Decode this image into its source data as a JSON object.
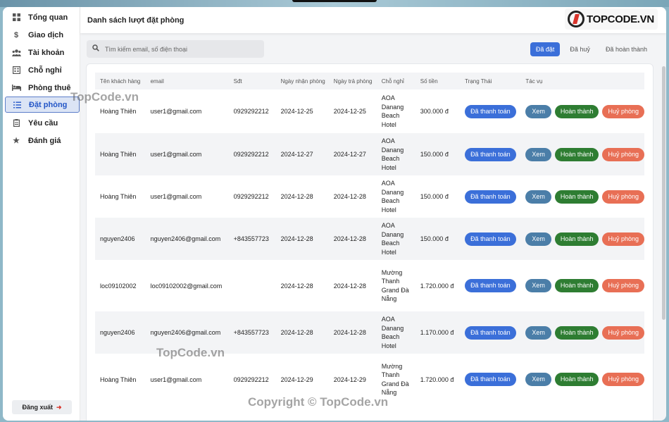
{
  "sidebar": {
    "items": [
      {
        "label": "Tổng quan",
        "icon": "grid-icon"
      },
      {
        "label": "Giao dịch",
        "icon": "dollar-icon"
      },
      {
        "label": "Tài khoản",
        "icon": "users-icon"
      },
      {
        "label": "Chỗ nghỉ",
        "icon": "building-icon"
      },
      {
        "label": "Phòng thuê",
        "icon": "bed-icon"
      },
      {
        "label": "Đặt phòng",
        "icon": "list-icon"
      },
      {
        "label": "Yêu cầu",
        "icon": "clipboard-icon"
      },
      {
        "label": "Đánh giá",
        "icon": "star-icon"
      }
    ],
    "active_index": 5,
    "logout_label": "Đăng xuất"
  },
  "header": {
    "title": "Danh sách lượt đặt phòng",
    "brand": {
      "part1": "TOP",
      "part2": "CODE.VN"
    }
  },
  "search": {
    "placeholder": "Tìm kiếm email, số điện thoại"
  },
  "filters": {
    "booked": "Đã đặt",
    "cancelled": "Đã huỷ",
    "completed": "Đã hoàn thành"
  },
  "table": {
    "columns": [
      "Tên khách hàng",
      "email",
      "Sđt",
      "Ngày nhận phòng",
      "Ngày trả phòng",
      "Chỗ nghỉ",
      "Số tiền",
      "Trạng Thái",
      "Tác vụ"
    ],
    "status_label": "Đã thanh toán",
    "view_label": "Xem",
    "complete_label": "Hoàn thành",
    "cancel_label": "Huỷ phòng",
    "rows": [
      {
        "name": "Hoàng Thiên",
        "email": "user1@gmail.com",
        "phone": "0929292212",
        "checkin": "2024-12-25",
        "checkout": "2024-12-25",
        "place": "AOA Danang Beach Hotel",
        "amount": "300.000 đ"
      },
      {
        "name": "Hoàng Thiên",
        "email": "user1@gmail.com",
        "phone": "0929292212",
        "checkin": "2024-12-27",
        "checkout": "2024-12-27",
        "place": "AOA Danang Beach Hotel",
        "amount": "150.000 đ"
      },
      {
        "name": "Hoàng Thiên",
        "email": "user1@gmail.com",
        "phone": "0929292212",
        "checkin": "2024-12-28",
        "checkout": "2024-12-28",
        "place": "AOA Danang Beach Hotel",
        "amount": "150.000 đ"
      },
      {
        "name": "nguyen2406",
        "email": "nguyen2406@gmail.com",
        "phone": "+843557723",
        "checkin": "2024-12-28",
        "checkout": "2024-12-28",
        "place": "AOA Danang Beach Hotel",
        "amount": "150.000 đ"
      },
      {
        "name": "loc09102002",
        "email": "loc09102002@gmail.com",
        "phone": "",
        "checkin": "2024-12-28",
        "checkout": "2024-12-28",
        "place": "Mường Thanh Grand Đà Nẵng",
        "amount": "1.720.000 đ"
      },
      {
        "name": "nguyen2406",
        "email": "nguyen2406@gmail.com",
        "phone": "+843557723",
        "checkin": "2024-12-28",
        "checkout": "2024-12-28",
        "place": "AOA Danang Beach Hotel",
        "amount": "1.170.000 đ"
      },
      {
        "name": "Hoàng Thiên",
        "email": "user1@gmail.com",
        "phone": "0929292212",
        "checkin": "2024-12-29",
        "checkout": "2024-12-29",
        "place": "Mường Thanh Grand Đà Nẵng",
        "amount": "1.720.000 đ"
      }
    ]
  },
  "watermarks": [
    "TopCode.vn",
    "TopCode.vn",
    "Copyright © TopCode.vn"
  ]
}
